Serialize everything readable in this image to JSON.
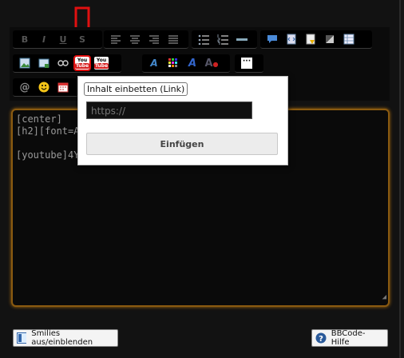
{
  "toolbar": {
    "row1": [
      "bold-icon",
      "italic-icon",
      "underline-icon",
      "strikethrough-icon",
      "align-left-icon",
      "align-center-icon",
      "align-right-icon",
      "justify-icon",
      "bullet-list-icon",
      "numbered-list-icon",
      "horizontal-rule-icon",
      "quote-icon",
      "code-icon",
      "spoiler-icon",
      "note-icon",
      "table-icon"
    ],
    "row2": [
      "image-icon",
      "attachment-icon",
      "link-icon",
      "youtube-icon",
      "youtube-alt-icon",
      "font-icon",
      "color-grid-icon",
      "font-size-icon",
      "clear-format-icon",
      "more-icon"
    ],
    "row3": [
      "mention-icon",
      "smiley-icon",
      "date-icon"
    ],
    "bold_label": "B",
    "italic_label": "I",
    "underline_label": "U",
    "youtube_top": "You",
    "youtube_bottom": "Tube",
    "more_label": "···"
  },
  "editor": {
    "content": "[center]\n[h2][font=A\n\n[youtube]4Y"
  },
  "popup": {
    "label": "Inhalt einbetten (Link)",
    "input_placeholder": "https://",
    "submit_label": "Einfügen"
  },
  "footer": {
    "smilies_label": "Smilies aus/einblenden",
    "help_label": "BBCode-Hilfe"
  },
  "colors": {
    "highlight": "#e01010",
    "editor_border": "#8a5a10"
  }
}
